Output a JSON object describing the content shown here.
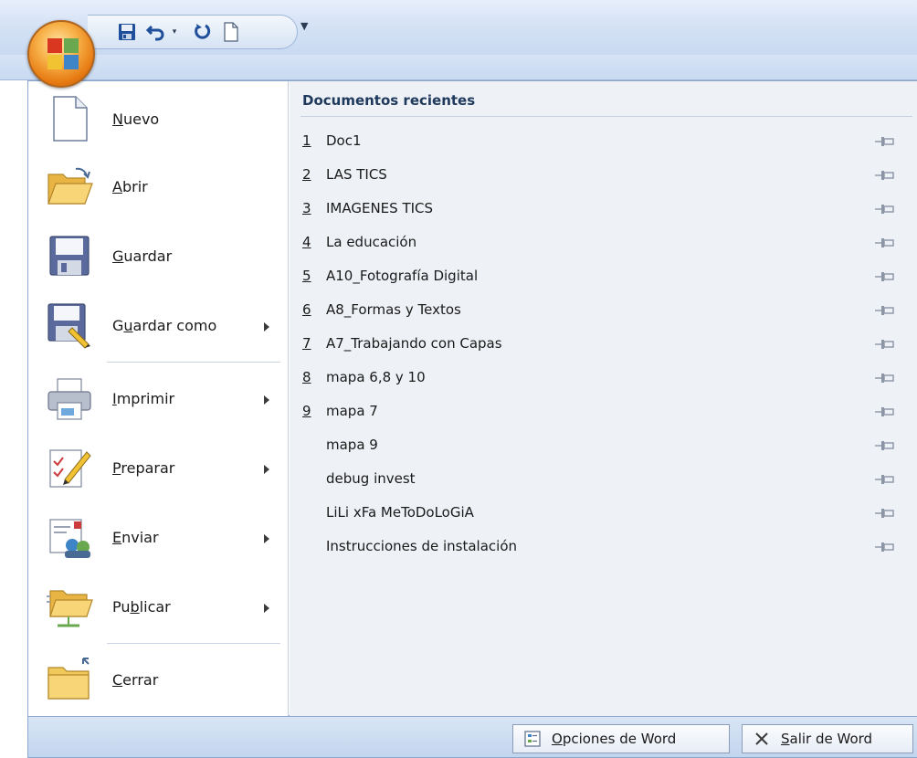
{
  "quick_access": {
    "buttons": [
      "save-icon",
      "undo-icon",
      "redo-icon",
      "new-document-icon"
    ],
    "dropdown_glyph": "▼"
  },
  "menu": {
    "items": [
      {
        "label": "Nuevo",
        "icon": "new-document-icon",
        "has_submenu": false
      },
      {
        "label": "Abrir",
        "icon": "open-folder-icon",
        "has_submenu": false
      },
      {
        "label": "Guardar",
        "icon": "save-icon",
        "has_submenu": false
      },
      {
        "label": "Guardar como",
        "icon": "save-as-icon",
        "has_submenu": true
      },
      {
        "label": "Imprimir",
        "icon": "printer-icon",
        "has_submenu": true
      },
      {
        "label": "Preparar",
        "icon": "prepare-icon",
        "has_submenu": true
      },
      {
        "label": "Enviar",
        "icon": "send-icon",
        "has_submenu": true
      },
      {
        "label": "Publicar",
        "icon": "publish-icon",
        "has_submenu": true
      },
      {
        "label": "Cerrar",
        "icon": "close-folder-icon",
        "has_submenu": false
      }
    ]
  },
  "recent": {
    "title": "Documentos recientes",
    "items": [
      {
        "num": "1",
        "name": "Doc1"
      },
      {
        "num": "2",
        "name": "LAS TICS"
      },
      {
        "num": "3",
        "name": "IMAGENES TICS"
      },
      {
        "num": "4",
        "name": "La educación"
      },
      {
        "num": "5",
        "name": "A10_Fotografía Digital"
      },
      {
        "num": "6",
        "name": "A8_Formas y Textos"
      },
      {
        "num": "7",
        "name": "A7_Trabajando con Capas"
      },
      {
        "num": "8",
        "name": "mapa 6,8 y 10"
      },
      {
        "num": "9",
        "name": "mapa 7"
      },
      {
        "num": "",
        "name": "mapa 9"
      },
      {
        "num": "",
        "name": "debug invest"
      },
      {
        "num": "",
        "name": "LiLi xFa MeToDoLoGiA"
      },
      {
        "num": "",
        "name": "Instrucciones de instalación"
      }
    ]
  },
  "footer": {
    "options_label": "Opciones de Word",
    "exit_label": "Salir de Word"
  }
}
